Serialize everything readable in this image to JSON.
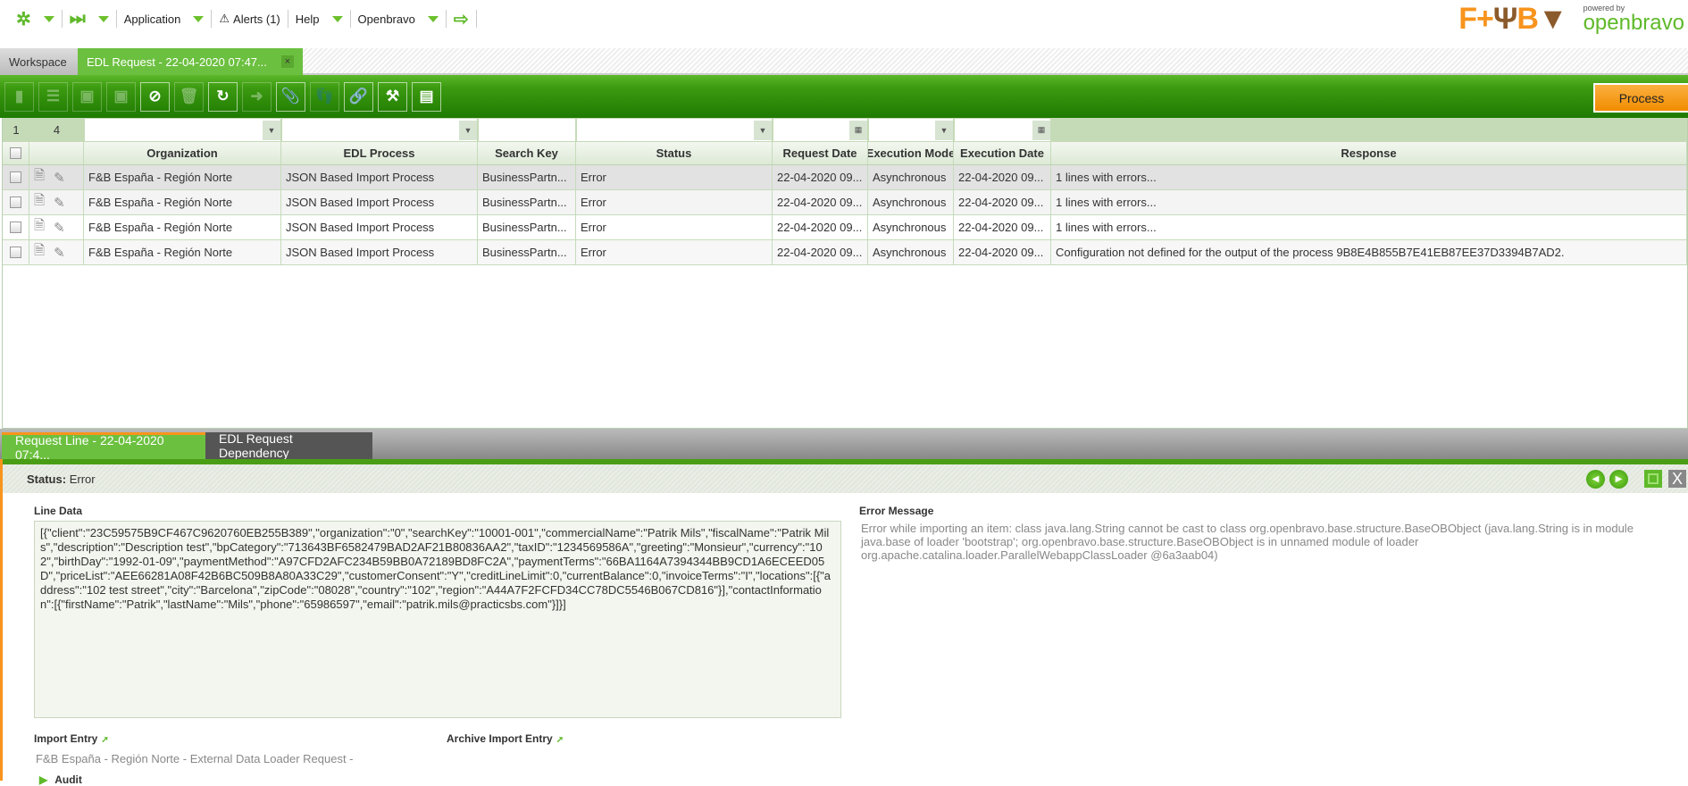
{
  "topnav": {
    "application": "Application",
    "alerts": "Alerts (1)",
    "help": "Help",
    "openbravo": "Openbravo"
  },
  "logos": {
    "fb": "F+B",
    "powered_by": "powered by",
    "openbravo": "openbravo"
  },
  "tabs": {
    "workspace": "Workspace",
    "active": "EDL Request - 22-04-2020 07:47...",
    "close": "×"
  },
  "toolbar": {
    "process": "Process"
  },
  "grid": {
    "page": "1",
    "count": "4",
    "columns": [
      "Organization",
      "EDL Process",
      "Search Key",
      "Status",
      "Request Date",
      "Execution Mode",
      "Execution Date",
      "Response"
    ],
    "rows": [
      [
        "F&B España - Región Norte",
        "JSON Based Import Process",
        "BusinessPartn...",
        "Error",
        "22-04-2020 09...",
        "Asynchronous",
        "22-04-2020 09...",
        "1 lines with errors..."
      ],
      [
        "F&B España - Región Norte",
        "JSON Based Import Process",
        "BusinessPartn...",
        "Error",
        "22-04-2020 09...",
        "Asynchronous",
        "22-04-2020 09...",
        "1 lines with errors..."
      ],
      [
        "F&B España - Región Norte",
        "JSON Based Import Process",
        "BusinessPartn...",
        "Error",
        "22-04-2020 09...",
        "Asynchronous",
        "22-04-2020 09...",
        "1 lines with errors..."
      ],
      [
        "F&B España - Región Norte",
        "JSON Based Import Process",
        "BusinessPartn...",
        "Error",
        "22-04-2020 09...",
        "Asynchronous",
        "22-04-2020 09...",
        "Configuration not defined for the output of the process 9B8E4B855B7E41EB87EE37D3394B7AD2."
      ]
    ]
  },
  "subtabs": {
    "active": "Request Line - 22-04-2020 07:4...",
    "other": "EDL Request Dependency"
  },
  "form": {
    "status_label": "Status:",
    "status_value": "Error",
    "line_data_label": "Line Data",
    "line_data": "[{\"client\":\"23C59575B9CF467C9620760EB255B389\",\"organization\":\"0\",\"searchKey\":\"10001-001\",\"commercialName\":\"Patrik Mils\",\"fiscalName\":\"Patrik Mils\",\"description\":\"Description test\",\"bpCategory\":\"713643BF6582479BAD2AF21B80836AA2\",\"taxID\":\"1234569586A\",\"greeting\":\"Monsieur\",\"currency\":\"102\",\"birthDay\":\"1992-01-09\",\"paymentMethod\":\"A97CFD2AFC234B59BB0A72189BD8FC2A\",\"paymentTerms\":\"66BA1164A7394344BB9CD1A6ECEED05D\",\"priceList\":\"AEE66281A08F42B6BC509B8A80A33C29\",\"customerConsent\":\"Y\",\"creditLineLimit\":0,\"currentBalance\":0,\"invoiceTerms\":\"I\",\"locations\":[{\"address\":\"102 test street\",\"city\":\"Barcelona\",\"zipCode\":\"08028\",\"country\":\"102\",\"region\":\"A44A7F2FCFD34CC78DC5546B067CD816\"}],\"contactInformation\":[{\"firstName\":\"Patrik\",\"lastName\":\"Mils\",\"phone\":\"65986597\",\"email\":\"patrik.mils@practicsbs.com\"}]}]",
    "error_label": "Error Message",
    "error_message": "Error while importing an item: class java.lang.String cannot be cast to class org.openbravo.base.structure.BaseOBObject (java.lang.String is in module java.base of loader 'bootstrap'; org.openbravo.base.structure.BaseOBObject is in unnamed module of loader org.apache.catalina.loader.ParallelWebappClassLoader @6a3aab04)",
    "import_entry_label": "Import Entry",
    "import_entry_value": "F&B España - Región Norte - External Data Loader Request -",
    "archive_label": "Archive Import Entry",
    "audit_label": "Audit"
  }
}
